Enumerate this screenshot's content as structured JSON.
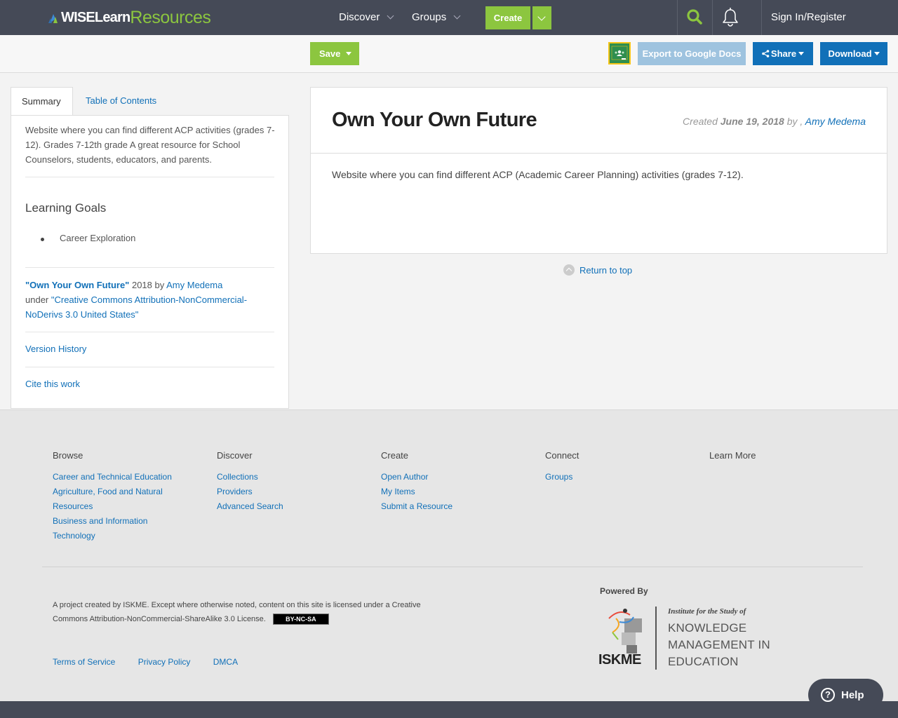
{
  "header": {
    "logo_wise": "WISELearn",
    "logo_resources": "Resources",
    "nav_discover": "Discover",
    "nav_groups": "Groups",
    "create_label": "Create",
    "signin_label": "Sign In/Register"
  },
  "toolbar": {
    "save_label": "Save",
    "export_label": "Export to Google Docs",
    "share_label": "Share",
    "download_label": "Download"
  },
  "sidebar": {
    "tab_summary": "Summary",
    "tab_toc": "Table of Contents",
    "summary_text": "Website where you can find different ACP activities (grades 7-12). Grades 7-12th grade A great resource for School Counselors, students, educators, and parents.",
    "learning_goals_title": "Learning Goals",
    "goals": [
      "Career Exploration"
    ],
    "attribution": {
      "title": "\"Own Your Own Future\"",
      "year_by": " 2018 by ",
      "author": "Amy Medema",
      "under": "under ",
      "license": "\"Creative Commons Attribution-NonCommercial-NoDerivs 3.0 United States\""
    },
    "version_history": "Version History",
    "cite": "Cite this work"
  },
  "main": {
    "title": "Own Your Own Future",
    "created_prefix": "Created ",
    "created_date": "June 19, 2018",
    "created_by": " by , ",
    "created_author": "Amy Medema",
    "description": "Website where you can find different ACP (Academic Career Planning) activities (grades 7-12).",
    "return_top": "Return to top"
  },
  "footer": {
    "browse_title": "Browse",
    "browse_links": [
      "Career and Technical Education",
      "Agriculture, Food and Natural Resources",
      "Business and Information Technology"
    ],
    "discover_title": "Discover",
    "discover_links": [
      "Collections",
      "Providers",
      "Advanced Search"
    ],
    "create_title": "Create",
    "create_links": [
      "Open Author",
      "My Items",
      "Submit a Resource"
    ],
    "connect_title": "Connect",
    "connect_links": [
      "Groups"
    ],
    "learn_title": "Learn More",
    "notice": "A project created by ISKME. Except where otherwise noted, content on this site is licensed under a Creative Commons Attribution-NonCommercial-ShareAlike 3.0 License.",
    "cc_badge": "BY-NC-SA",
    "terms": "Terms of Service",
    "privacy": "Privacy Policy",
    "dmca": "DMCA",
    "powered_by": "Powered By",
    "iskme_label": "ISKME",
    "iskme_institute": "Institute for the Study of",
    "iskme_line1": "KNOWLEDGE",
    "iskme_line2": "MANAGEMENT IN",
    "iskme_line3": "EDUCATION"
  },
  "help": {
    "label": "Help"
  },
  "icons": {
    "search": "search-icon",
    "bell": "bell-icon",
    "help": "help-icon"
  },
  "colors": {
    "nav_bg": "#454a57",
    "green": "#8cc63f",
    "blue": "#1170b8",
    "light_blue": "#9ec3df"
  }
}
